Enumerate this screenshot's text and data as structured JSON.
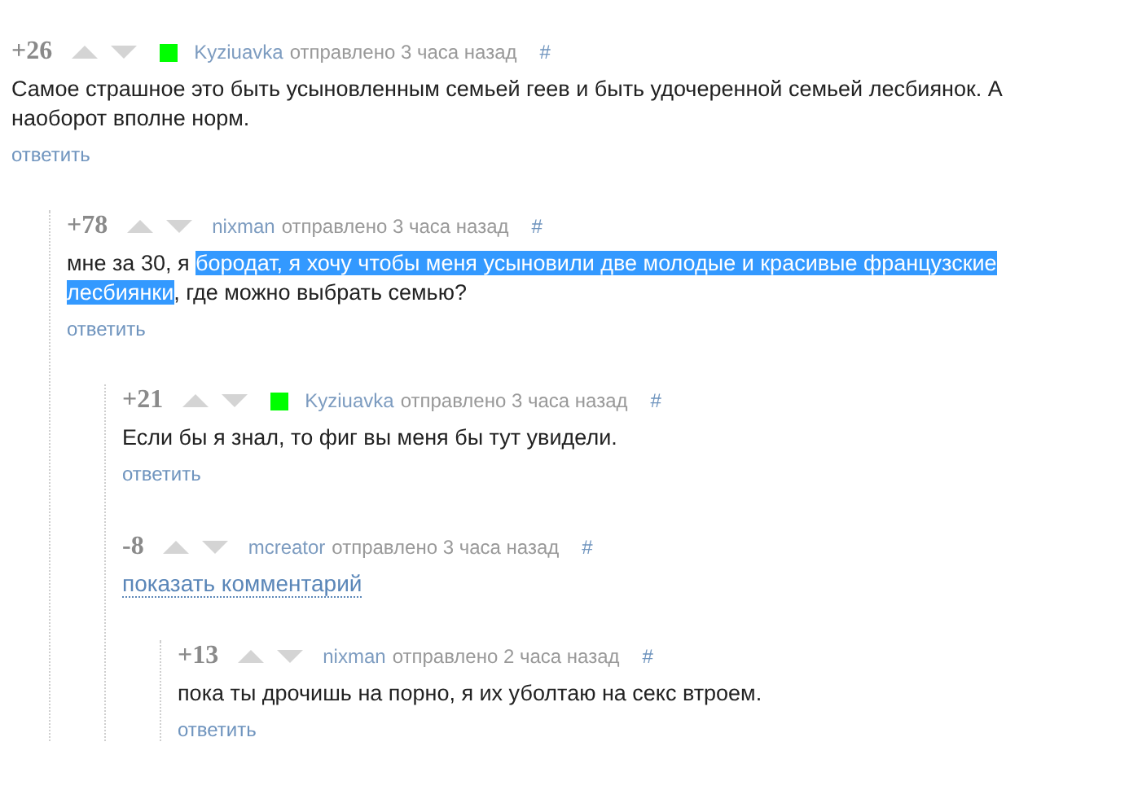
{
  "comments": [
    {
      "kind": "comment",
      "rating": "+26",
      "author": "Kyziuavka",
      "badge": true,
      "time": "отправлено 3 часа назад",
      "anchor": "#",
      "body": [
        {
          "text": "Самое страшное это быть усыновленным семьей геев и быть удочеренной семьей лесбиянок. А наоборот вполне норм.",
          "highlighted": false
        }
      ],
      "reply": "ответить",
      "children": [
        {
          "kind": "comment",
          "rating": "+78",
          "author": "nixman",
          "badge": false,
          "time": "отправлено 3 часа назад",
          "anchor": "#",
          "body": [
            {
              "text": "мне за 30, я ",
              "highlighted": false
            },
            {
              "text": "бородат, я хочу чтобы меня усыновили две молодые и красивые французские лесбиянки",
              "highlighted": true
            },
            {
              "text": ", где можно выбрать семью?",
              "highlighted": false
            }
          ],
          "reply": "ответить",
          "children": [
            {
              "kind": "comment",
              "rating": "+21",
              "author": "Kyziuavka",
              "badge": true,
              "time": "отправлено 3 часа назад",
              "anchor": "#",
              "body": [
                {
                  "text": "Если бы я знал, то фиг вы меня бы тут увидели.",
                  "highlighted": false
                }
              ],
              "reply": "ответить"
            },
            {
              "kind": "hidden",
              "rating": "-8",
              "author": "mcreator",
              "badge": false,
              "time": "отправлено 3 часа назад",
              "anchor": "#",
              "show_link": "показать комментарий",
              "children": [
                {
                  "kind": "comment",
                  "rating": "+13",
                  "author": "nixman",
                  "badge": false,
                  "time": "отправлено 2 часа назад",
                  "anchor": "#",
                  "body": [
                    {
                      "text": "пока ты дрочишь на порно, я их уболтаю на секс втроем.",
                      "highlighted": false
                    }
                  ],
                  "reply": "ответить"
                }
              ]
            }
          ]
        }
      ]
    }
  ]
}
